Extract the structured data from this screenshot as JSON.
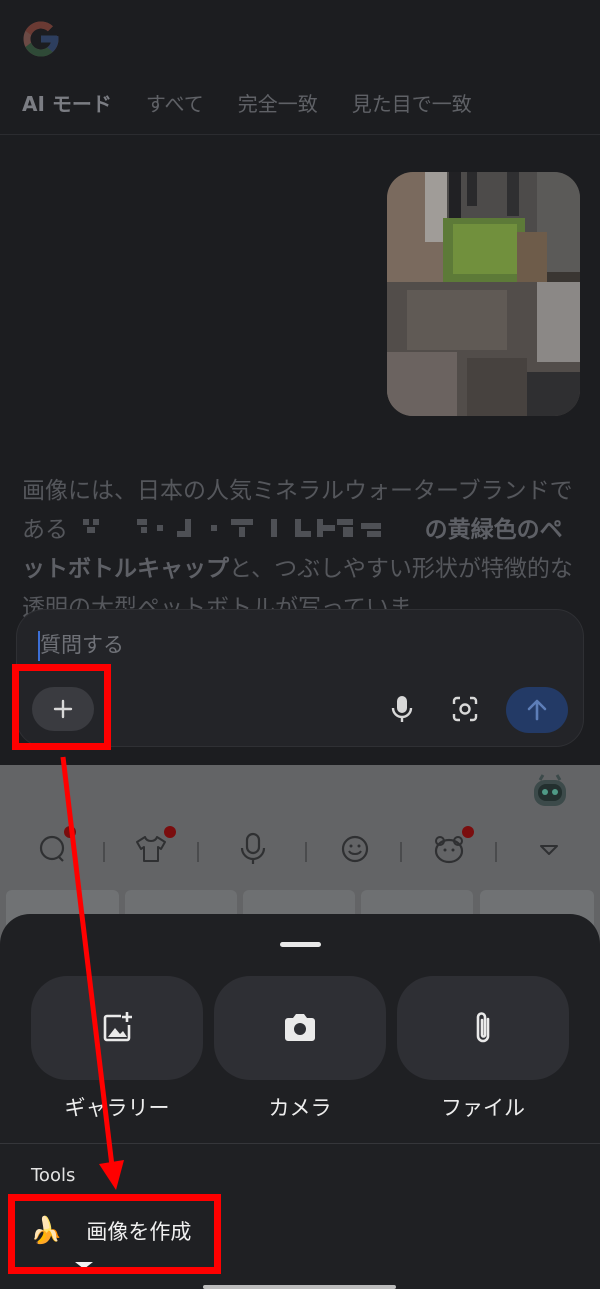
{
  "tabs": [
    "AI モード",
    "すべて",
    "完全一致",
    "見た目で一致"
  ],
  "answer": {
    "line1": "画像には、日本の人気ミネラルウォーターブランドである",
    "bold": "の黄緑色のペットボトルキャップ",
    "line2": "と、つぶしやすい形状が特徴的な透明の大型ペットボトルが写っていま"
  },
  "input": {
    "placeholder": "質問する"
  },
  "attachments": [
    {
      "label": "ギャラリー",
      "icon": "gallery-add-icon"
    },
    {
      "label": "カメラ",
      "icon": "camera-icon"
    },
    {
      "label": "ファイル",
      "icon": "paperclip-icon"
    }
  ],
  "tools": {
    "heading": "Tools",
    "create_image": {
      "label": "画像を作成",
      "icon": "banana-icon",
      "emoji": "🍌"
    }
  },
  "colors": {
    "annotation": "#ff0000",
    "send_button": "#233a66"
  }
}
